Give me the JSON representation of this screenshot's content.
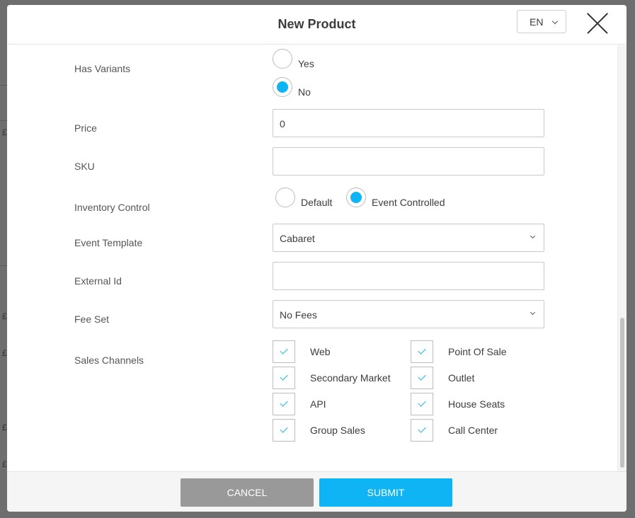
{
  "modal": {
    "title": "New Product",
    "language": "EN"
  },
  "backdrop_glyphs": [
    "£",
    "£",
    "£",
    "£",
    "£"
  ],
  "form": {
    "has_variants": {
      "label": "Has Variants",
      "options": [
        "Yes",
        "No"
      ],
      "selected": "No"
    },
    "price": {
      "label": "Price",
      "value": "0"
    },
    "sku": {
      "label": "SKU",
      "value": ""
    },
    "inventory_control": {
      "label": "Inventory Control",
      "options": [
        "Default",
        "Event Controlled"
      ],
      "selected": "Event Controlled"
    },
    "event_template": {
      "label": "Event Template",
      "value": "Cabaret"
    },
    "external_id": {
      "label": "External Id",
      "value": ""
    },
    "fee_set": {
      "label": "Fee Set",
      "value": "No Fees"
    },
    "sales_channels": {
      "label": "Sales Channels",
      "items": [
        {
          "label": "Web",
          "checked": true
        },
        {
          "label": "Point Of Sale",
          "checked": true
        },
        {
          "label": "Secondary Market",
          "checked": true
        },
        {
          "label": "Outlet",
          "checked": true
        },
        {
          "label": "API",
          "checked": true
        },
        {
          "label": "House Seats",
          "checked": true
        },
        {
          "label": "Group Sales",
          "checked": true
        },
        {
          "label": "Call Center",
          "checked": true
        }
      ]
    }
  },
  "footer": {
    "cancel_label": "CANCEL",
    "submit_label": "SUBMIT"
  },
  "colors": {
    "accent": "#0fb4f4",
    "cancel": "#999999"
  }
}
